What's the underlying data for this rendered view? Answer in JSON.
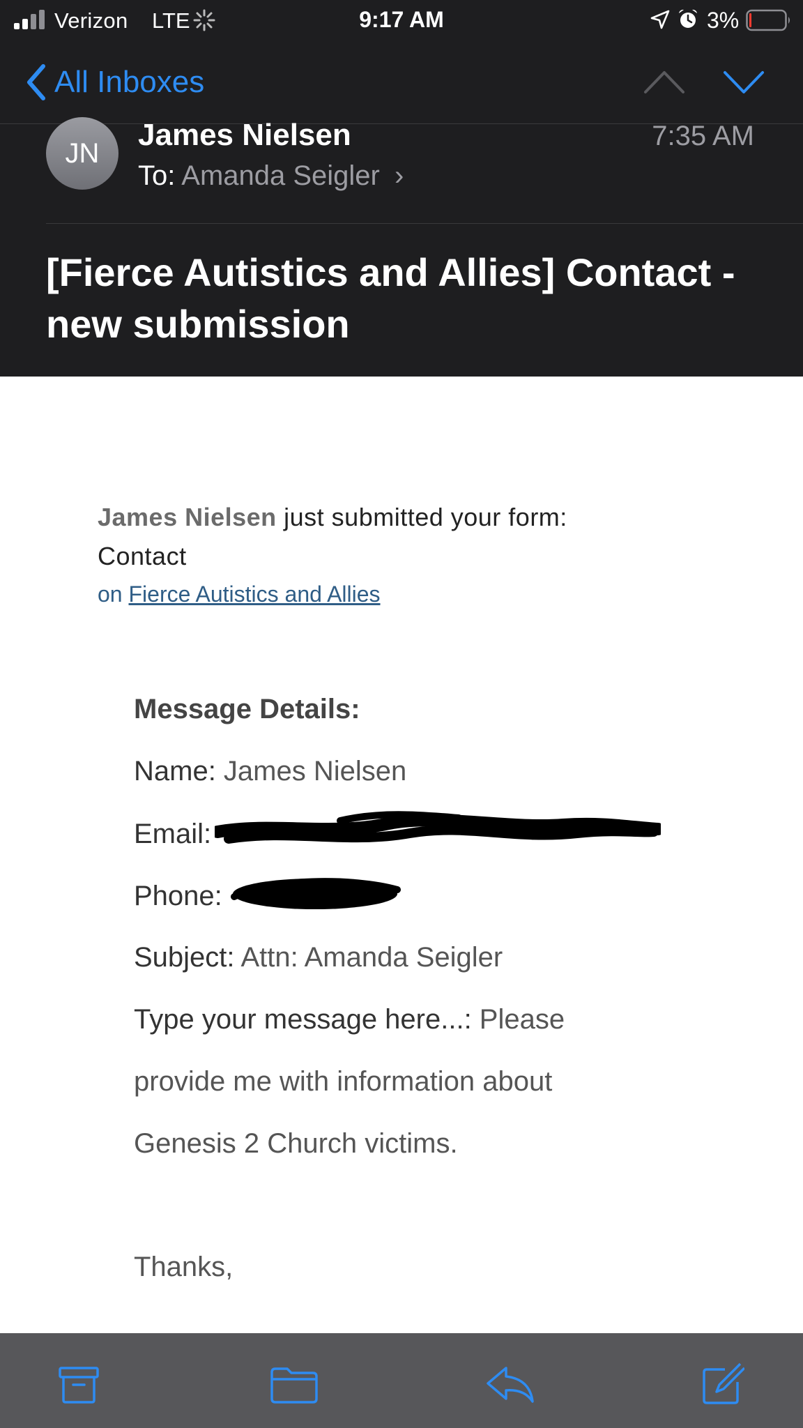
{
  "status_bar": {
    "carrier": "Verizon",
    "network": "LTE",
    "time": "9:17 AM",
    "battery": "3%",
    "icons": [
      "signal-icon",
      "activity-spinner-icon",
      "location-icon",
      "alarm-icon",
      "battery-icon"
    ]
  },
  "nav": {
    "back_label": "All Inboxes",
    "icons": [
      "back-chevron-icon",
      "previous-message-icon",
      "next-message-icon"
    ]
  },
  "header": {
    "avatar_initials": "JN",
    "sender": "James Nielsen",
    "to_label": "To:",
    "recipient": "Amanda Seigler",
    "time": "7:35 AM",
    "subject": "[Fierce Autistics and Allies] Contact - new submission"
  },
  "body": {
    "intro_name": "James Nielsen",
    "intro_rest": " just submitted your form: Contact",
    "on_prefix": "on ",
    "site_link": "Fierce Autistics and Allies",
    "details_heading": "Message Details:",
    "name_label": "Name:",
    "name_value": " James Nielsen",
    "email_label": "Email:",
    "phone_label": "Phone:",
    "subject_label": "Subject:",
    "subject_value": " Attn: Amanda Seigler",
    "message_label": "Type your message here...:",
    "message_line1": " Please",
    "message_line2": "provide me with information about",
    "message_line3": "Genesis 2 Church victims.",
    "thanks": "Thanks,"
  },
  "toolbar": {
    "icons": [
      "archive-icon",
      "folder-icon",
      "reply-icon",
      "compose-icon"
    ]
  },
  "colors": {
    "accent": "#2e8cf2",
    "header_bg": "#1e1e20",
    "toolbar_bg": "#57575a",
    "secondary_text": "#9d9da3"
  }
}
